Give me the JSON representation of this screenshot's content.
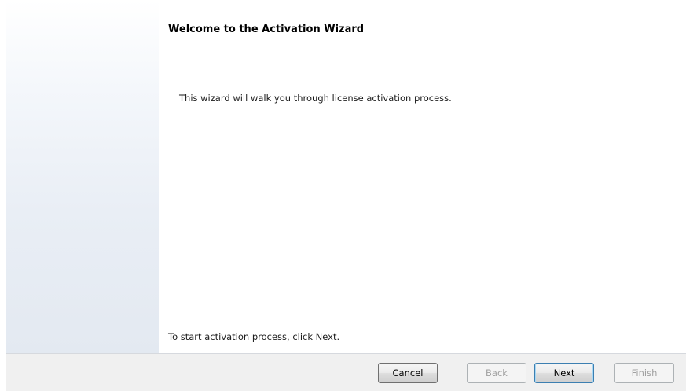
{
  "wizard": {
    "title": "Welcome to the Activation Wizard",
    "intro": "This wizard will walk you through license activation process.",
    "footer": "To start activation process, click Next."
  },
  "buttons": {
    "cancel": "Cancel",
    "back": "Back",
    "next": "Next",
    "finish": "Finish"
  },
  "button_states": {
    "cancel": "enabled",
    "back": "disabled",
    "next": "enabled-default",
    "finish": "disabled"
  },
  "colors": {
    "side_panel_gradient_top": "#ffffff",
    "side_panel_gradient_bottom": "#e3e9f1",
    "button_bar_background": "#f0f0f0",
    "disabled_text": "#a0a0a0"
  }
}
